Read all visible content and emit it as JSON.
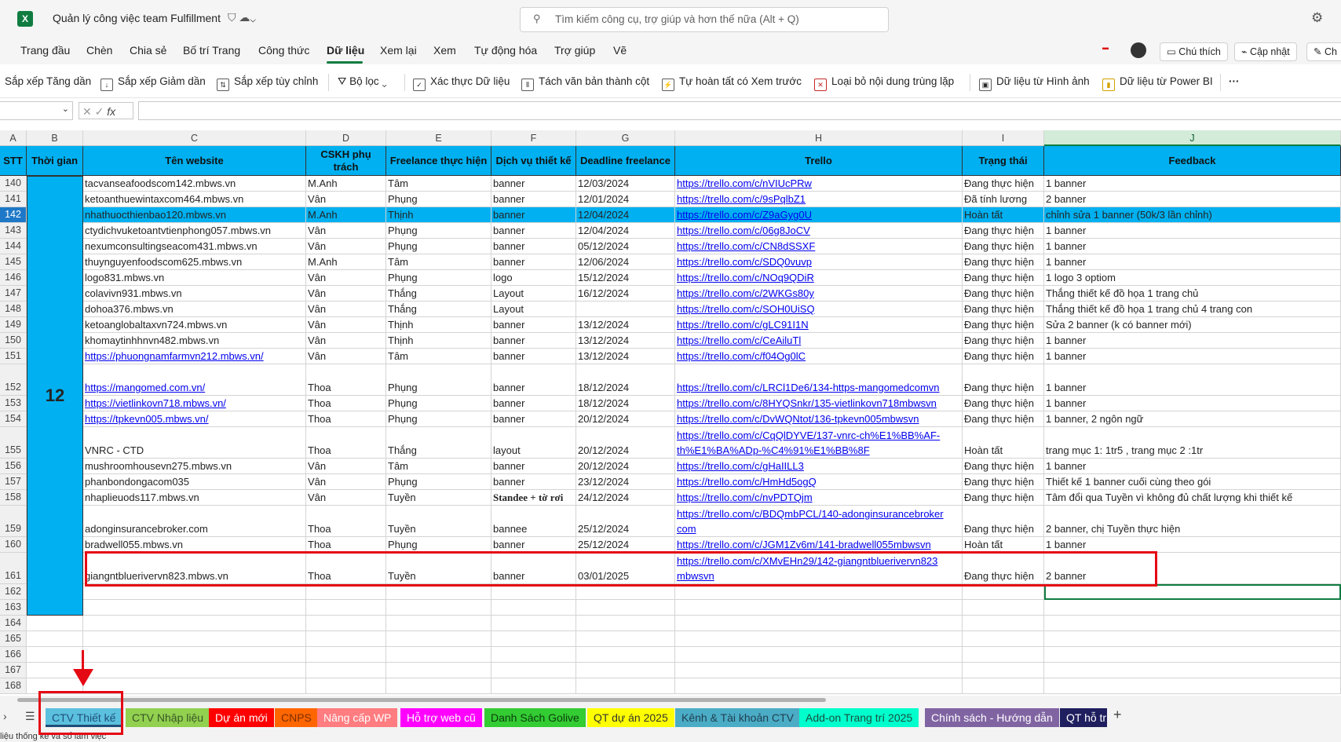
{
  "app": {
    "title": "Quản lý công việc team Fulfillment",
    "search_placeholder": "Tìm kiếm công cụ, trợ giúp và hơn thế nữa (Alt + Q)"
  },
  "menu": [
    "Trang đầu",
    "Chèn",
    "Chia sẻ",
    "Bố trí Trang",
    "Công thức",
    "Dữ liệu",
    "Xem lại",
    "Xem",
    "Tự động hóa",
    "Trợ giúp",
    "Vẽ"
  ],
  "menu_active": "Dữ liệu",
  "top_buttons": {
    "comment": "Chú thích",
    "update": "Cập nhật",
    "edit_short": "Ch"
  },
  "ribbon": [
    "Sắp xếp Tăng dần",
    "Sắp xếp Giảm dần",
    "Sắp xếp tùy chỉnh",
    "Bộ lọc",
    "Xác thực Dữ liệu",
    "Tách văn bản thành cột",
    "Tự hoàn tất có Xem trước",
    "Loại bỏ nội dung trùng lặp",
    "Dữ liệu từ Hình ảnh",
    "Dữ liệu từ Power BI",
    "···"
  ],
  "columns": [
    "A",
    "B",
    "C",
    "D",
    "E",
    "F",
    "G",
    "H",
    "I",
    "J"
  ],
  "headers": [
    "STT",
    "Thời gian",
    "Tên website",
    "CSKH phụ trách",
    "Freelance thực hiện",
    "Dịch vụ thiết kế",
    "Deadline freelance",
    "Trello",
    "Trạng thái",
    "Feedback"
  ],
  "month_label": "12",
  "rows": [
    {
      "rn": "140",
      "c": [
        "140",
        "",
        "tacvanseafoodscom142.mbws.vn",
        "M.Anh",
        "Tâm",
        "banner",
        "12/03/2024",
        "https://trello.com/c/nVIUcPRw",
        "Đang thực hiện",
        "1 banner"
      ]
    },
    {
      "rn": "141",
      "c": [
        "141",
        "",
        "ketoanthuewintaxcom464.mbws.vn",
        "Vân",
        "Phụng",
        "banner",
        "12/01/2024",
        "https://trello.com/c/9sPqlbZ1",
        "Đã tính lương",
        "2 banner"
      ]
    },
    {
      "rn": "142",
      "c": [
        "142",
        "",
        "nhathuocthienbao120.mbws.vn",
        "M.Anh",
        "Thịnh",
        "banner",
        "12/04/2024",
        "https://trello.com/c/Z9aGyg0U",
        "Hoàn tất",
        "chỉnh sửa 1 banner (50k/3 lần chỉnh)"
      ]
    },
    {
      "rn": "143",
      "c": [
        "143",
        "",
        "ctydichvuketoantvtienphong057.mbws.vn",
        "Vân",
        "Phụng",
        "banner",
        "12/04/2024",
        "https://trello.com/c/06g8JoCV",
        "Đang thực hiện",
        "1 banner"
      ]
    },
    {
      "rn": "144",
      "c": [
        "144",
        "",
        "nexumconsultingseacom431.mbws.vn",
        "Vân",
        "Phụng",
        "banner",
        "05/12/2024",
        "https://trello.com/c/CN8dSSXF",
        "Đang thực hiện",
        "1 banner"
      ]
    },
    {
      "rn": "145",
      "c": [
        "145",
        "",
        "thuynguyenfoodscom625.mbws.vn",
        "M.Anh",
        "Tâm",
        "banner",
        "12/06/2024",
        "https://trello.com/c/SDQ0vuvp",
        "Đang thực hiện",
        "1 banner"
      ]
    },
    {
      "rn": "146",
      "c": [
        "146",
        "",
        "logo831.mbws.vn",
        "Vân",
        "Phụng",
        "logo",
        "15/12/2024",
        "https://trello.com/c/NOq9QDiR",
        "Đang thực hiện",
        "1 logo 3 optiom"
      ]
    },
    {
      "rn": "147",
      "c": [
        "147",
        "",
        "colavivn931.mbws.vn",
        "Vân",
        "Thắng",
        "Layout",
        "16/12/2024",
        "https://trello.com/c/2WKGs80y",
        "Đang thực hiện",
        "Thắng thiết kế đồ họa 1 trang chủ"
      ]
    },
    {
      "rn": "148",
      "c": [
        "148",
        "",
        "dohoa376.mbws.vn",
        "Vân",
        "Thắng",
        "Layout",
        "",
        "https://trello.com/c/SOH0UiSQ",
        "Đang thực hiện",
        "Thắng thiết kế đồ họa 1 trang chủ 4 trang con"
      ]
    },
    {
      "rn": "149",
      "c": [
        "149",
        "",
        "ketoanglobaltaxvn724.mbws.vn",
        "Vân",
        "Thịnh",
        "banner",
        "13/12/2024",
        "https://trello.com/c/gLC91I1N",
        "Đang thực hiện",
        "Sửa 2 banner (k có banner mới)"
      ]
    },
    {
      "rn": "150",
      "c": [
        "150",
        "",
        "khomaytinhhnvn482.mbws.vn",
        "Vân",
        "Thịnh",
        "banner",
        "13/12/2024",
        "https://trello.com/c/CeAiluTl",
        "Đang thực hiện",
        "1 banner"
      ]
    },
    {
      "rn": "151",
      "c": [
        "151",
        "",
        "https://phuongnamfarmvn212.mbws.vn/",
        "Vân",
        "Tâm",
        "banner",
        "13/12/2024",
        "https://trello.com/c/f04Og0lC",
        "Đang thực hiện",
        "1 banner"
      ]
    },
    {
      "rn": "152",
      "c": [
        "152",
        "",
        "https://mangomed.com.vn/",
        "Thoa",
        "Phụng",
        "banner",
        "18/12/2024",
        "https://trello.com/c/LRCl1De6/134-https-mangomedcomvn",
        "Đang thực hiện",
        "1 banner"
      ]
    },
    {
      "rn": "153",
      "c": [
        "153",
        "",
        "https://vietlinkovn718.mbws.vn/",
        "Thoa",
        "Phụng",
        "banner",
        "18/12/2024",
        "https://trello.com/c/8HYQSnkr/135-vietlinkovn718mbwsvn",
        "Đang thực hiện",
        "1 banner"
      ]
    },
    {
      "rn": "154",
      "c": [
        "154",
        "",
        "https://tpkevn005.mbws.vn/",
        "Thoa",
        "Phụng",
        "banner",
        "20/12/2024",
        "https://trello.com/c/DvWQNtot/136-tpkevn005mbwsvn",
        "Đang thực hiện",
        "1 banner, 2 ngôn ngữ"
      ]
    },
    {
      "rn": "155",
      "c": [
        "155",
        "",
        "VNRC - CTD",
        "Thoa",
        "Thắng",
        "layout",
        "20/12/2024",
        "https://trello.com/c/CqQlDYVE/137-vnrc-ch%E1%BB%AF-th%E1%BA%ADp-%C4%91%E1%BB%8F",
        "Hoàn tất",
        "trang mục 1: 1tr5 , trang mục 2 :1tr"
      ]
    },
    {
      "rn": "156",
      "c": [
        "156",
        "",
        "mushroomhousevn275.mbws.vn",
        "Vân",
        "Tâm",
        "banner",
        "20/12/2024",
        "https://trello.com/c/gHaIILL3",
        "Đang thực hiện",
        "1 banner"
      ]
    },
    {
      "rn": "157",
      "c": [
        "157",
        "",
        "phanbondongacom035",
        "Vân",
        "Phụng",
        "banner",
        "23/12/2024",
        "https://trello.com/c/HmHd5ogQ",
        "Đang thực hiện",
        "Thiết kế 1 banner cuối cùng theo gói"
      ]
    },
    {
      "rn": "158",
      "c": [
        "158",
        "",
        "nhaplieuods117.mbws.vn",
        "Vân",
        "Tuyền",
        "Standee + tờ rơi",
        "24/12/2024",
        "https://trello.com/c/nvPDTQjm",
        "Đang thực hiện",
        "Tâm đổi qua Tuyền vì không đủ chất lượng khi thiết kế"
      ]
    },
    {
      "rn": "159",
      "c": [
        "159",
        "",
        "adonginsurancebroker.com",
        "Thoa",
        "Tuyền",
        "bannee",
        "25/12/2024",
        "https://trello.com/c/BDQmbPCL/140-adonginsurancebroker com",
        "Đang thực hiện",
        "2 banner, chị Tuyền thực hiện"
      ]
    },
    {
      "rn": "160",
      "c": [
        "160",
        "",
        "bradwell055.mbws.vn",
        "Thoa",
        "Phụng",
        "banner",
        "25/12/2024",
        "https://trello.com/c/JGM1Zv6m/141-bradwell055mbwsvn",
        "Hoàn tất",
        "1 banner"
      ]
    },
    {
      "rn": "161",
      "c": [
        "161",
        "",
        "giangntbluerivervn823.mbws.vn",
        "Thoa",
        "Tuyền",
        "banner",
        "03/01/2025",
        "https://trello.com/c/XMvEHn29/142-giangntbluerivervn823 mbwsvn",
        "Đang thực hiện",
        "2 banner"
      ]
    },
    {
      "rn": "162",
      "c": [
        "",
        "",
        "",
        "",
        "",
        "",
        "",
        "",
        "",
        ""
      ]
    },
    {
      "rn": "163",
      "c": [
        "",
        "",
        "",
        "",
        "",
        "",
        "",
        "",
        "",
        ""
      ]
    },
    {
      "rn": "164",
      "c": [
        "",
        "",
        "",
        "",
        "",
        "",
        "",
        "",
        "",
        ""
      ]
    },
    {
      "rn": "165",
      "c": [
        "",
        "",
        "",
        "",
        "",
        "",
        "",
        "",
        "",
        ""
      ]
    },
    {
      "rn": "166",
      "c": [
        "",
        "",
        "",
        "",
        "",
        "",
        "",
        "",
        "",
        ""
      ]
    },
    {
      "rn": "167",
      "c": [
        "",
        "",
        "",
        "",
        "",
        "",
        "",
        "",
        "",
        ""
      ]
    },
    {
      "rn": "168",
      "c": [
        "",
        "",
        "",
        "",
        "",
        "",
        "",
        "",
        "",
        ""
      ]
    }
  ],
  "sheet_tabs": [
    {
      "label": "CTV Thiết kế",
      "bg": "#5bc0de",
      "fg": "#1f4e79"
    },
    {
      "label": "CTV Nhập liệu",
      "bg": "#92d050",
      "fg": "#375623"
    },
    {
      "label": "Dự án mới",
      "bg": "#ff0000",
      "fg": "#ffffff"
    },
    {
      "label": "CNPS",
      "bg": "#ff6600",
      "fg": "#7a2e00"
    },
    {
      "label": "Nâng cấp WP",
      "bg": "#ff7c80",
      "fg": "#ffffff"
    },
    {
      "label": "Hỗ trợ web cũ",
      "bg": "#ff00ff",
      "fg": "#ffffff"
    },
    {
      "label": "Danh Sách Golive",
      "bg": "#33cc33",
      "fg": "#0b3d0b"
    },
    {
      "label": "QT dự án 2025",
      "bg": "#ffff00",
      "fg": "#333333"
    },
    {
      "label": "Kênh & Tài khoản CTV",
      "bg": "#4bacc6",
      "fg": "#1f3f4f"
    },
    {
      "label": "Add-on Trang trí 2025",
      "bg": "#00ffcc",
      "fg": "#1a4d40"
    },
    {
      "label": "Chính sách - Hướng dẫn",
      "bg": "#8064a2",
      "fg": "#ffffff"
    },
    {
      "label": "QT hỗ tr",
      "bg": "#1f1f5f",
      "fg": "#ffffff"
    }
  ],
  "status_text": "liệu thống kê và sổ làm việc",
  "highlight_color": "#e50914",
  "header_color": "#00b0f0"
}
